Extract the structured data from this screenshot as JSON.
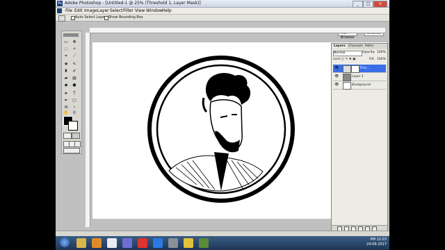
{
  "window": {
    "title": "Adobe Photoshop - [Untitled-1 @ 25% (Threshold 1, Layer Mask)]"
  },
  "window_controls": {
    "minimize": "_",
    "maximize": "□",
    "close": "×"
  },
  "menu": [
    "File",
    "Edit",
    "Image",
    "Layer",
    "Select",
    "Filter",
    "View",
    "Window",
    "Help"
  ],
  "options": {
    "auto_select": "Auto Select Layer",
    "show_bbox": "Show Bounding Box"
  },
  "wells": {
    "file_browser": "File Browser",
    "brushes": "Brushes"
  },
  "layers_panel": {
    "tabs": [
      "Layers",
      "Channels",
      "Paths"
    ],
    "blend_mode": "Normal",
    "opacity_label": "Opacity:",
    "opacity_value": "100%",
    "lock_label": "Lock:",
    "fill_label": "Fill:",
    "fill_value": "100%",
    "layers": [
      {
        "name": "Thre..."
      },
      {
        "name": "Layer 1"
      },
      {
        "name": "Background"
      }
    ]
  },
  "taskbar": {
    "time": "PM 12:03",
    "date": "24-09-2017"
  }
}
